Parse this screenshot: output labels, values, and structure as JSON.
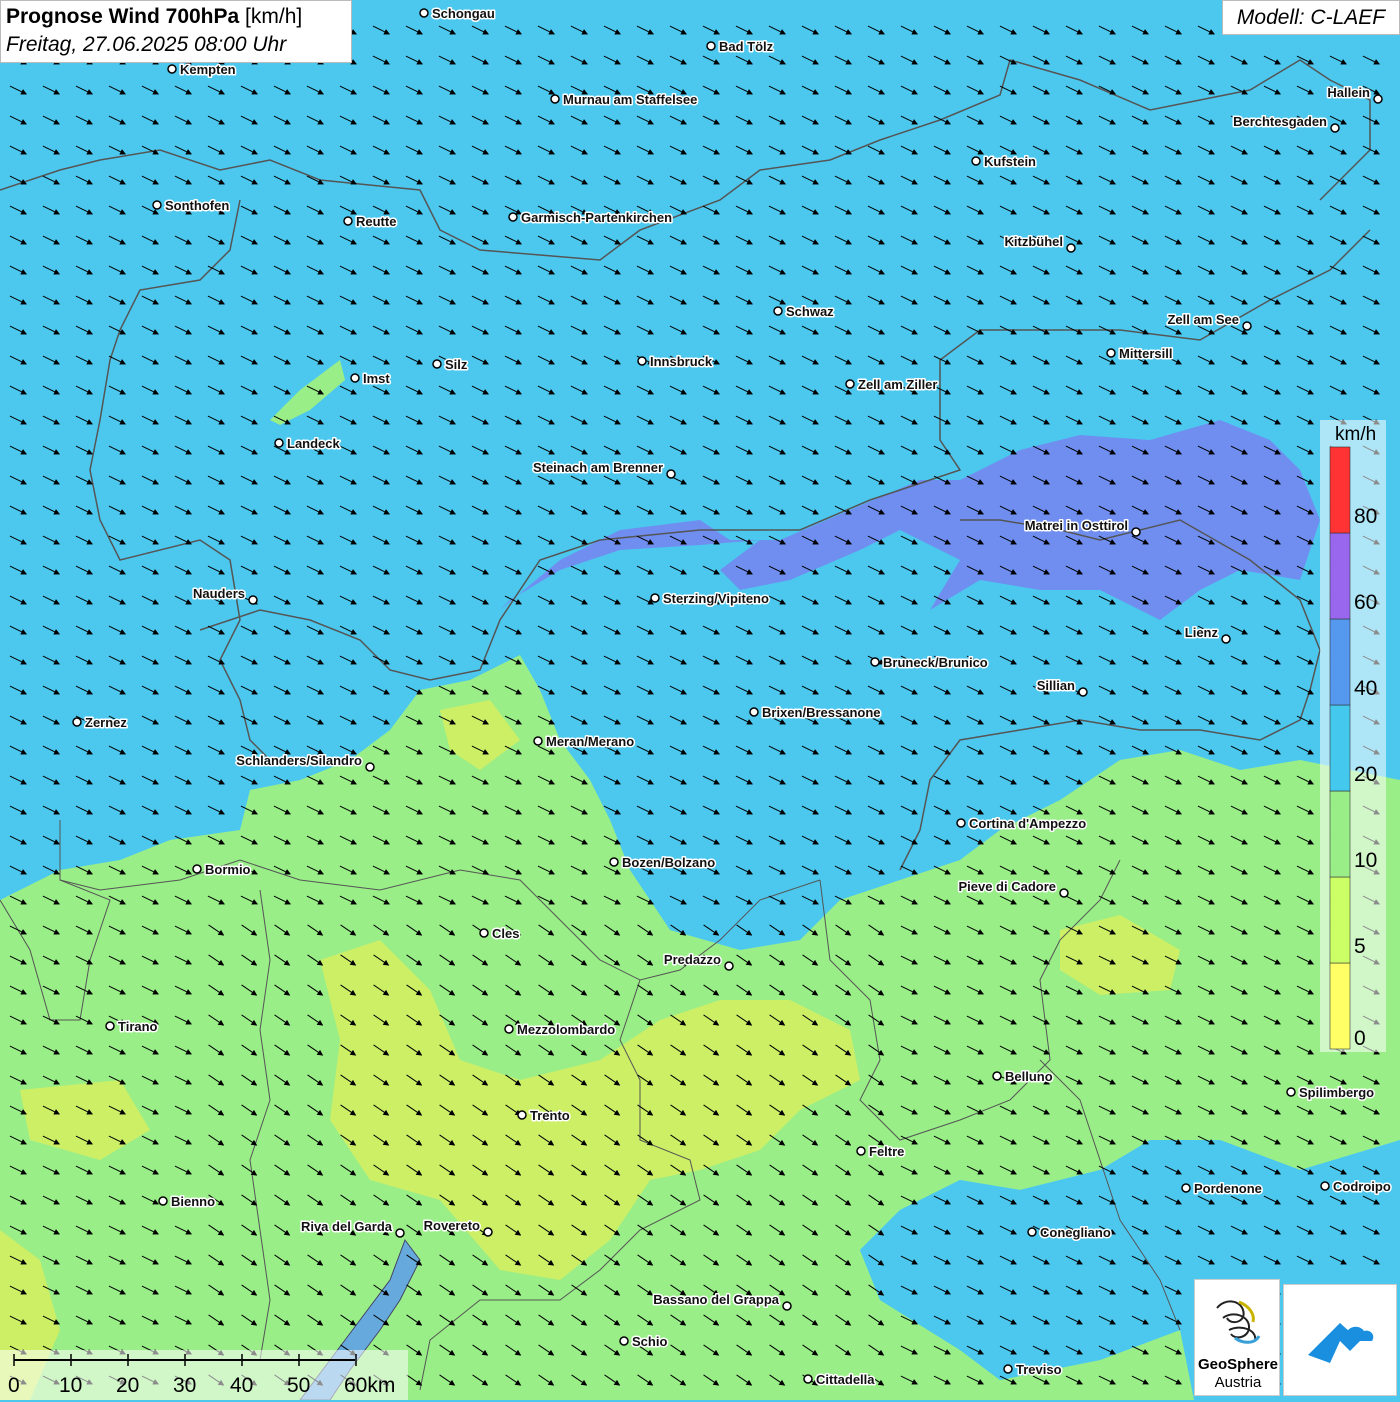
{
  "header": {
    "title_bold": "Prognose Wind 700hPa",
    "title_unit": "[km/h]",
    "date": "Freitag, 27.06.2025 08:00 Uhr",
    "model": "Modell: C-LAEF"
  },
  "legend": {
    "unit": "km/h",
    "ticks": [
      "0",
      "5",
      "10",
      "20",
      "40",
      "60",
      "80"
    ],
    "colors": [
      "#ffff66",
      "#ccff66",
      "#99ee88",
      "#44c8ee",
      "#5599ee",
      "#9966ee",
      "#ff3333"
    ]
  },
  "scale": {
    "ticks": [
      "0",
      "10",
      "20",
      "30",
      "40",
      "50",
      "60km"
    ]
  },
  "logo": {
    "line1": "GeoSphere",
    "line2": "Austria"
  },
  "cities": [
    {
      "name": "Schongau"
    },
    {
      "name": "Bad Tölz"
    },
    {
      "name": "Kempten"
    },
    {
      "name": "Murnau am Staffelsee"
    },
    {
      "name": "Hallein"
    },
    {
      "name": "Berchtesgaden"
    },
    {
      "name": "Kufstein"
    },
    {
      "name": "Sonthofen"
    },
    {
      "name": "Reutte"
    },
    {
      "name": "Garmisch-Partenkirchen"
    },
    {
      "name": "Kitzbühel"
    },
    {
      "name": "Schwaz"
    },
    {
      "name": "Zell am See"
    },
    {
      "name": "Mittersill"
    },
    {
      "name": "Innsbruck"
    },
    {
      "name": "Silz"
    },
    {
      "name": "Imst"
    },
    {
      "name": "Zell am Ziller"
    },
    {
      "name": "Landeck"
    },
    {
      "name": "Steinach am Brenner"
    },
    {
      "name": "Matrei in Osttirol"
    },
    {
      "name": "Nauders"
    },
    {
      "name": "Sterzing/Vipiteno"
    },
    {
      "name": "Lienz"
    },
    {
      "name": "Bruneck/Brunico"
    },
    {
      "name": "Sillian"
    },
    {
      "name": "Brixen/Bressanone"
    },
    {
      "name": "Zernez"
    },
    {
      "name": "Meran/Merano"
    },
    {
      "name": "Schlanders/Silandro"
    },
    {
      "name": "Cortina d'Ampezzo"
    },
    {
      "name": "Bozen/Bolzano"
    },
    {
      "name": "Bormio"
    },
    {
      "name": "Pieve di Cadore"
    },
    {
      "name": "Cles"
    },
    {
      "name": "Predazzo"
    },
    {
      "name": "Tirano"
    },
    {
      "name": "Mezzolombardo"
    },
    {
      "name": "Belluno"
    },
    {
      "name": "Spilimbergo"
    },
    {
      "name": "Trento"
    },
    {
      "name": "Feltre"
    },
    {
      "name": "Pordenone"
    },
    {
      "name": "Codroipo"
    },
    {
      "name": "Bienno"
    },
    {
      "name": "Riva del Garda"
    },
    {
      "name": "Rovereto"
    },
    {
      "name": "Conegliano"
    },
    {
      "name": "Bassano del Grappa"
    },
    {
      "name": "Schio"
    },
    {
      "name": "Treviso"
    },
    {
      "name": "Cittadella"
    }
  ]
}
